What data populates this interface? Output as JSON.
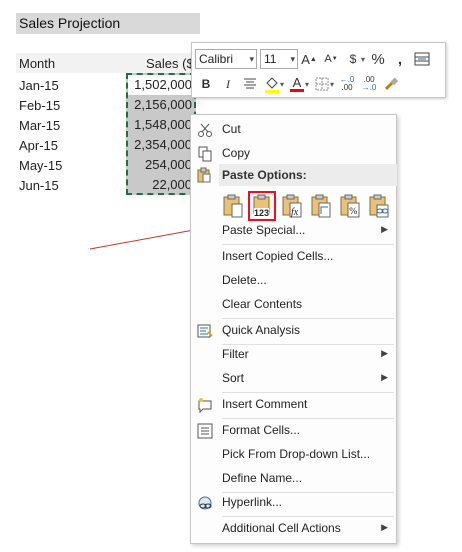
{
  "sheet": {
    "title": "Sales Projection",
    "header_month": "Month",
    "header_sales": "Sales ($",
    "months": [
      "Jan-15",
      "Feb-15",
      "Mar-15",
      "Apr-15",
      "May-15",
      "Jun-15"
    ],
    "values": [
      "1,502,000",
      "2,156,000",
      "1,548,000",
      "2,354,000",
      "254,000",
      "22,000"
    ]
  },
  "mini_toolbar": {
    "font_name": "Calibri",
    "font_size": "11",
    "grow_font": "A",
    "shrink_font": "A",
    "currency": "$",
    "percent": "%",
    "comma": ",",
    "bold": "B",
    "italic": "I",
    "font_color_letter": "A",
    "font_color": "#ff0000",
    "fill_color": "#ffff00"
  },
  "context_menu": {
    "cut": "Cut",
    "copy": "Copy",
    "paste_options": "Paste Options:",
    "paste_special": "Paste Special...",
    "insert_copied_cells": "Insert Copied Cells...",
    "delete": "Delete...",
    "clear_contents": "Clear Contents",
    "quick_analysis": "Quick Analysis",
    "filter": "Filter",
    "sort": "Sort",
    "insert_comment": "Insert Comment",
    "format_cells": "Format Cells...",
    "pick_from_list": "Pick From Drop-down List...",
    "define_name": "Define Name...",
    "hyperlink": "Hyperlink...",
    "additional_actions": "Additional Cell Actions",
    "paste_values_badge": "123",
    "paste_formula_badge": "fx"
  },
  "colors": {
    "selection_border": "#1e7145",
    "highlight_border": "#e81123",
    "annotation_line": "#c0392b"
  }
}
